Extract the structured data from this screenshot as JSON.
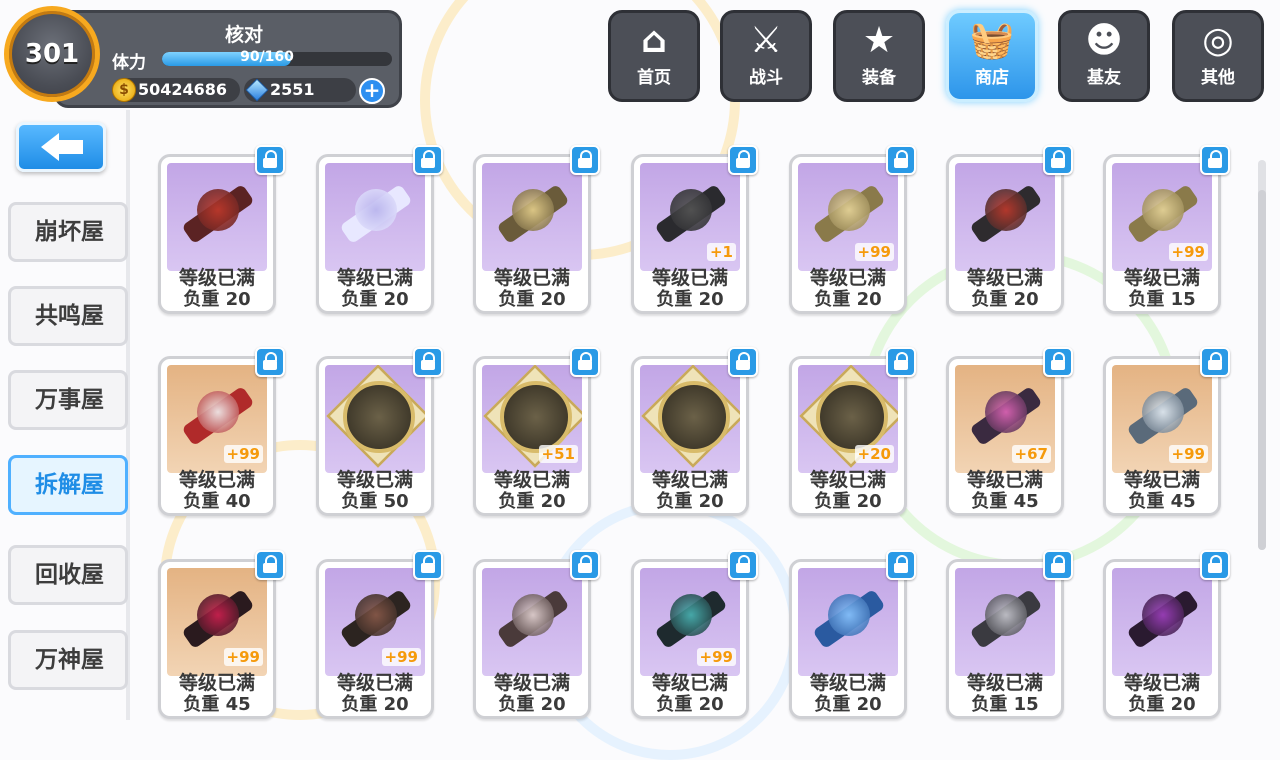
{
  "player": {
    "level": "301",
    "name": "核对",
    "stamina_label": "体力",
    "stamina_value": "90/160",
    "stamina_fraction": 0.5625,
    "coins": "50424686",
    "crystals": "2551"
  },
  "nav": {
    "home": "首页",
    "battle": "战斗",
    "equipment": "装备",
    "shop": "商店",
    "friends": "基友",
    "other": "其他"
  },
  "side_menu": [
    "崩坏屋",
    "共鸣屋",
    "万事屋",
    "拆解屋",
    "回收屋",
    "万神屋"
  ],
  "side_menu_active": "拆解屋",
  "colors": {
    "accent": "#2a9ae6",
    "count": "#f59a0c"
  },
  "items": [
    {
      "icon": "chainsaw-weapon-icon",
      "bg": "purple",
      "status": "等级已满",
      "weight": "负重 20",
      "count": ""
    },
    {
      "icon": "flower-cluster-icon",
      "bg": "purple",
      "status": "等级已满",
      "weight": "负重 20",
      "count": ""
    },
    {
      "icon": "golden-pistol-icon",
      "bg": "purple",
      "status": "等级已满",
      "weight": "负重 20",
      "count": ""
    },
    {
      "icon": "dark-rifle-icon",
      "bg": "purple",
      "status": "等级已满",
      "weight": "负重 20",
      "count": "+1"
    },
    {
      "icon": "cross-staff-icon",
      "bg": "purple",
      "status": "等级已满",
      "weight": "负重 20",
      "count": "+99"
    },
    {
      "icon": "red-armor-icon",
      "bg": "purple",
      "status": "等级已满",
      "weight": "负重 20",
      "count": ""
    },
    {
      "icon": "golden-cross-icon",
      "bg": "purple",
      "status": "等级已满",
      "weight": "负重 15",
      "count": "+99"
    },
    {
      "icon": "red-dress-icon",
      "bg": "orange",
      "status": "等级已满",
      "weight": "负重 40",
      "count": "+99"
    },
    {
      "icon": "gold-medal-icon",
      "bg": "purple",
      "status": "等级已满",
      "weight": "负重 50",
      "count": ""
    },
    {
      "icon": "gold-medal-mask-icon",
      "bg": "purple",
      "status": "等级已满",
      "weight": "负重 20",
      "count": "+51"
    },
    {
      "icon": "gold-medal-swirl-icon",
      "bg": "purple",
      "status": "等级已满",
      "weight": "负重 20",
      "count": ""
    },
    {
      "icon": "gold-medal-beast-icon",
      "bg": "purple",
      "status": "等级已满",
      "weight": "负重 20",
      "count": "+20"
    },
    {
      "icon": "pink-rifle-icon",
      "bg": "orange",
      "status": "等级已满",
      "weight": "负重 45",
      "count": "+67"
    },
    {
      "icon": "silver-cannon-icon",
      "bg": "orange",
      "status": "等级已满",
      "weight": "负重 45",
      "count": "+99"
    },
    {
      "icon": "red-chainblade-icon",
      "bg": "orange",
      "status": "等级已满",
      "weight": "负重 45",
      "count": "+99"
    },
    {
      "icon": "dark-spear-icon",
      "bg": "purple",
      "status": "等级已满",
      "weight": "负重 20",
      "count": "+99"
    },
    {
      "icon": "bone-staff-icon",
      "bg": "purple",
      "status": "等级已满",
      "weight": "负重 20",
      "count": ""
    },
    {
      "icon": "teal-rifle-icon",
      "bg": "purple",
      "status": "等级已满",
      "weight": "负重 20",
      "count": "+99"
    },
    {
      "icon": "blue-crystal-icon",
      "bg": "purple",
      "status": "等级已满",
      "weight": "负重 20",
      "count": ""
    },
    {
      "icon": "silver-crest-icon",
      "bg": "purple",
      "status": "等级已满",
      "weight": "负重 15",
      "count": ""
    },
    {
      "icon": "purple-armor-icon",
      "bg": "purple",
      "status": "等级已满",
      "weight": "负重 20",
      "count": ""
    }
  ]
}
